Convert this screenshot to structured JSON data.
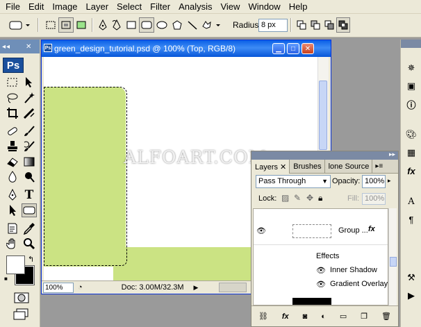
{
  "menu": [
    "File",
    "Edit",
    "Image",
    "Layer",
    "Select",
    "Filter",
    "Analysis",
    "View",
    "Window",
    "Help"
  ],
  "options": {
    "radius_label": "Radius:",
    "radius_value": "8 px"
  },
  "tools": {
    "logo": "Ps"
  },
  "document": {
    "title": "green_design_tutorial.psd @ 100% (Top, RGB/8)",
    "zoom": "100%",
    "doc_info": "Doc: 3.00M/32.3M"
  },
  "layers_panel": {
    "tabs": [
      "Layers",
      "Brushes",
      "lone Source"
    ],
    "blend_mode": "Pass Through",
    "opacity_label": "Opacity:",
    "opacity_value": "100%",
    "lock_label": "Lock:",
    "fill_label": "Fill:",
    "fill_value": "100%",
    "group_name": "Group ...",
    "effects_label": "Effects",
    "effects": [
      "Inner Shadow",
      "Gradient Overlay"
    ]
  },
  "watermark": "ALFOART.COM",
  "colors": {
    "canvas_green": "#cbe383",
    "title_blue": "#0a5fe6",
    "panel_bg": "#ece9d8"
  }
}
